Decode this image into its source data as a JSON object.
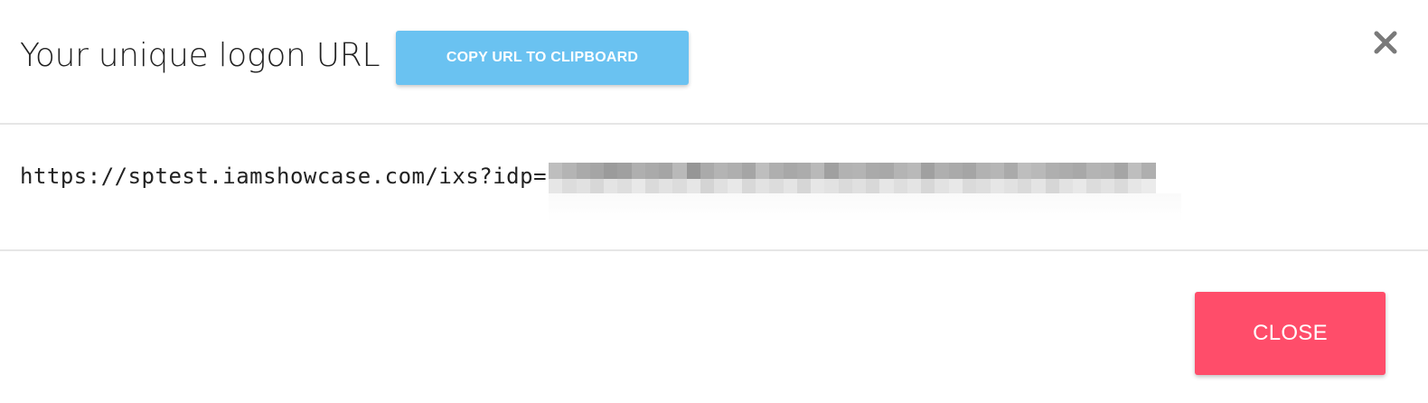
{
  "dialog": {
    "title": "Your unique logon URL",
    "copy_button_label": "COPY URL TO CLIPBOARD",
    "close_icon": "close-icon",
    "url_prefix": "https://sptest.iamshowcase.com/ixs?idp=",
    "url_value_redacted": true,
    "close_button_label": "CLOSE"
  },
  "colors": {
    "copy_button": "#6ac2f1",
    "close_button": "#ff4d6a",
    "divider": "#e6e6e6",
    "close_icon": "#7a7a7a"
  }
}
